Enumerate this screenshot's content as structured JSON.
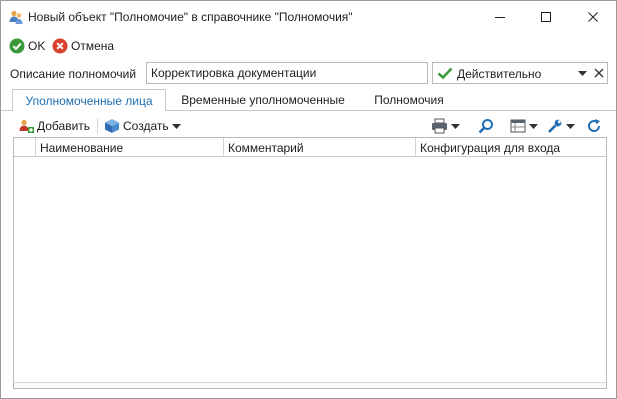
{
  "window": {
    "title": "Новый объект \"Полномочие\" в справочнике \"Полномочия\""
  },
  "actions": {
    "ok_label": "OK",
    "cancel_label": "Отмена"
  },
  "form": {
    "description_label": "Описание полномочий",
    "description_value": "Корректировка документации",
    "status_value": "Действительно"
  },
  "tabs": [
    {
      "label": "Уполномоченные лица",
      "active": true
    },
    {
      "label": "Временные уполномоченные",
      "active": false
    },
    {
      "label": "Полномочия",
      "active": false
    }
  ],
  "toolbar": {
    "add_label": "Добавить",
    "create_label": "Создать"
  },
  "grid": {
    "columns": [
      "Наименование",
      "Комментарий",
      "Конфигурация для входа"
    ],
    "rows": []
  },
  "colors": {
    "accent": "#1f6fb2",
    "ok_green": "#3a9a3a",
    "cancel_red": "#d9412f",
    "border": "#b9b9b9"
  },
  "icons": {
    "title": "users-icon",
    "ok": "check-circle-icon",
    "cancel": "cross-circle-icon",
    "status": "check-icon",
    "add": "add-user-icon",
    "create": "cube-icon",
    "print": "printer-icon",
    "find": "search-icon",
    "view": "table-view-icon",
    "settings": "wrench-icon",
    "refresh": "refresh-icon"
  }
}
